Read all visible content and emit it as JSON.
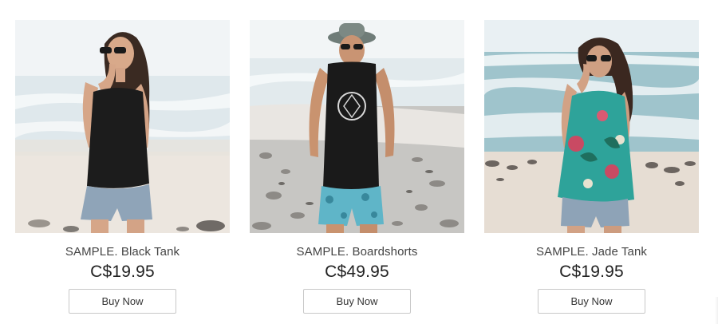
{
  "products": [
    {
      "title": "SAMPLE. Black Tank",
      "price": "C$19.95",
      "button_label": "Buy Now",
      "image_icon": "woman-black-tank-beach-photo"
    },
    {
      "title": "SAMPLE. Boardshorts",
      "price": "C$49.95",
      "button_label": "Buy Now",
      "image_icon": "man-boardshorts-beach-photo"
    },
    {
      "title": "SAMPLE. Jade Tank",
      "price": "C$19.95",
      "button_label": "Buy Now",
      "image_icon": "woman-jade-tank-beach-photo"
    }
  ],
  "colors": {
    "sky": "#eef2f4",
    "sea": "#cfdfe6",
    "sand": "#e9e2da",
    "black_tank": "#1c1c1c",
    "denim": "#8fa4b8",
    "jade": "#2ea39a",
    "boardshorts": "#5fb5c8",
    "button_border": "#c8c8c8"
  }
}
